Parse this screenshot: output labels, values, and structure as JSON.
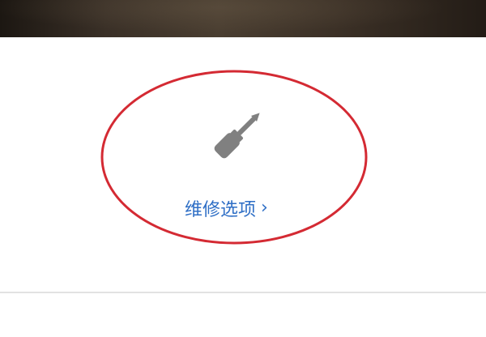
{
  "repair_option": {
    "label": "维修选项",
    "chevron": "›",
    "icon": "screwdriver-icon",
    "link_color": "#2f6fc6",
    "icon_color": "#808080"
  },
  "annotation": {
    "color": "#d42a33"
  }
}
